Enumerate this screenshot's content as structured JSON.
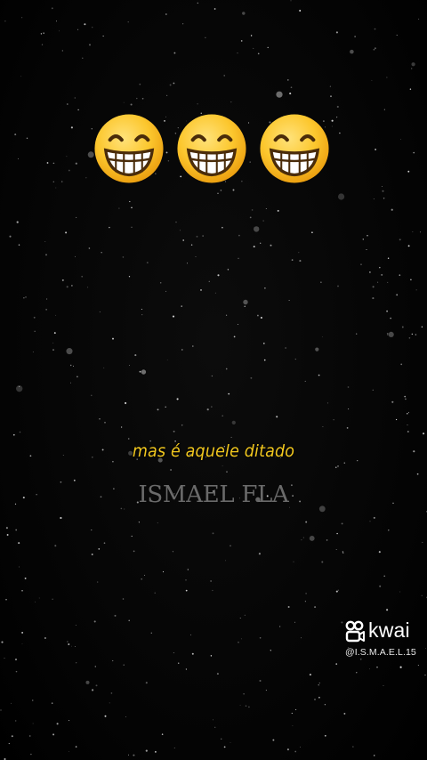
{
  "video": {
    "emojis": [
      {
        "icon": "grinning-face-with-smiling-eyes-icon",
        "glyph": "😁"
      },
      {
        "icon": "grinning-face-with-smiling-eyes-icon",
        "glyph": "😁"
      },
      {
        "icon": "grinning-face-with-smiling-eyes-icon",
        "glyph": "😁"
      }
    ],
    "caption": "mas é aquele ditado",
    "watermark": "ISMAEL FLA",
    "caption_color": "#f2c81e",
    "background_color": "#050505"
  },
  "branding": {
    "app_name": "kwai",
    "handle": "@I.S.M.A.E.L.15",
    "logo_icon": "kwai-logo-icon"
  }
}
